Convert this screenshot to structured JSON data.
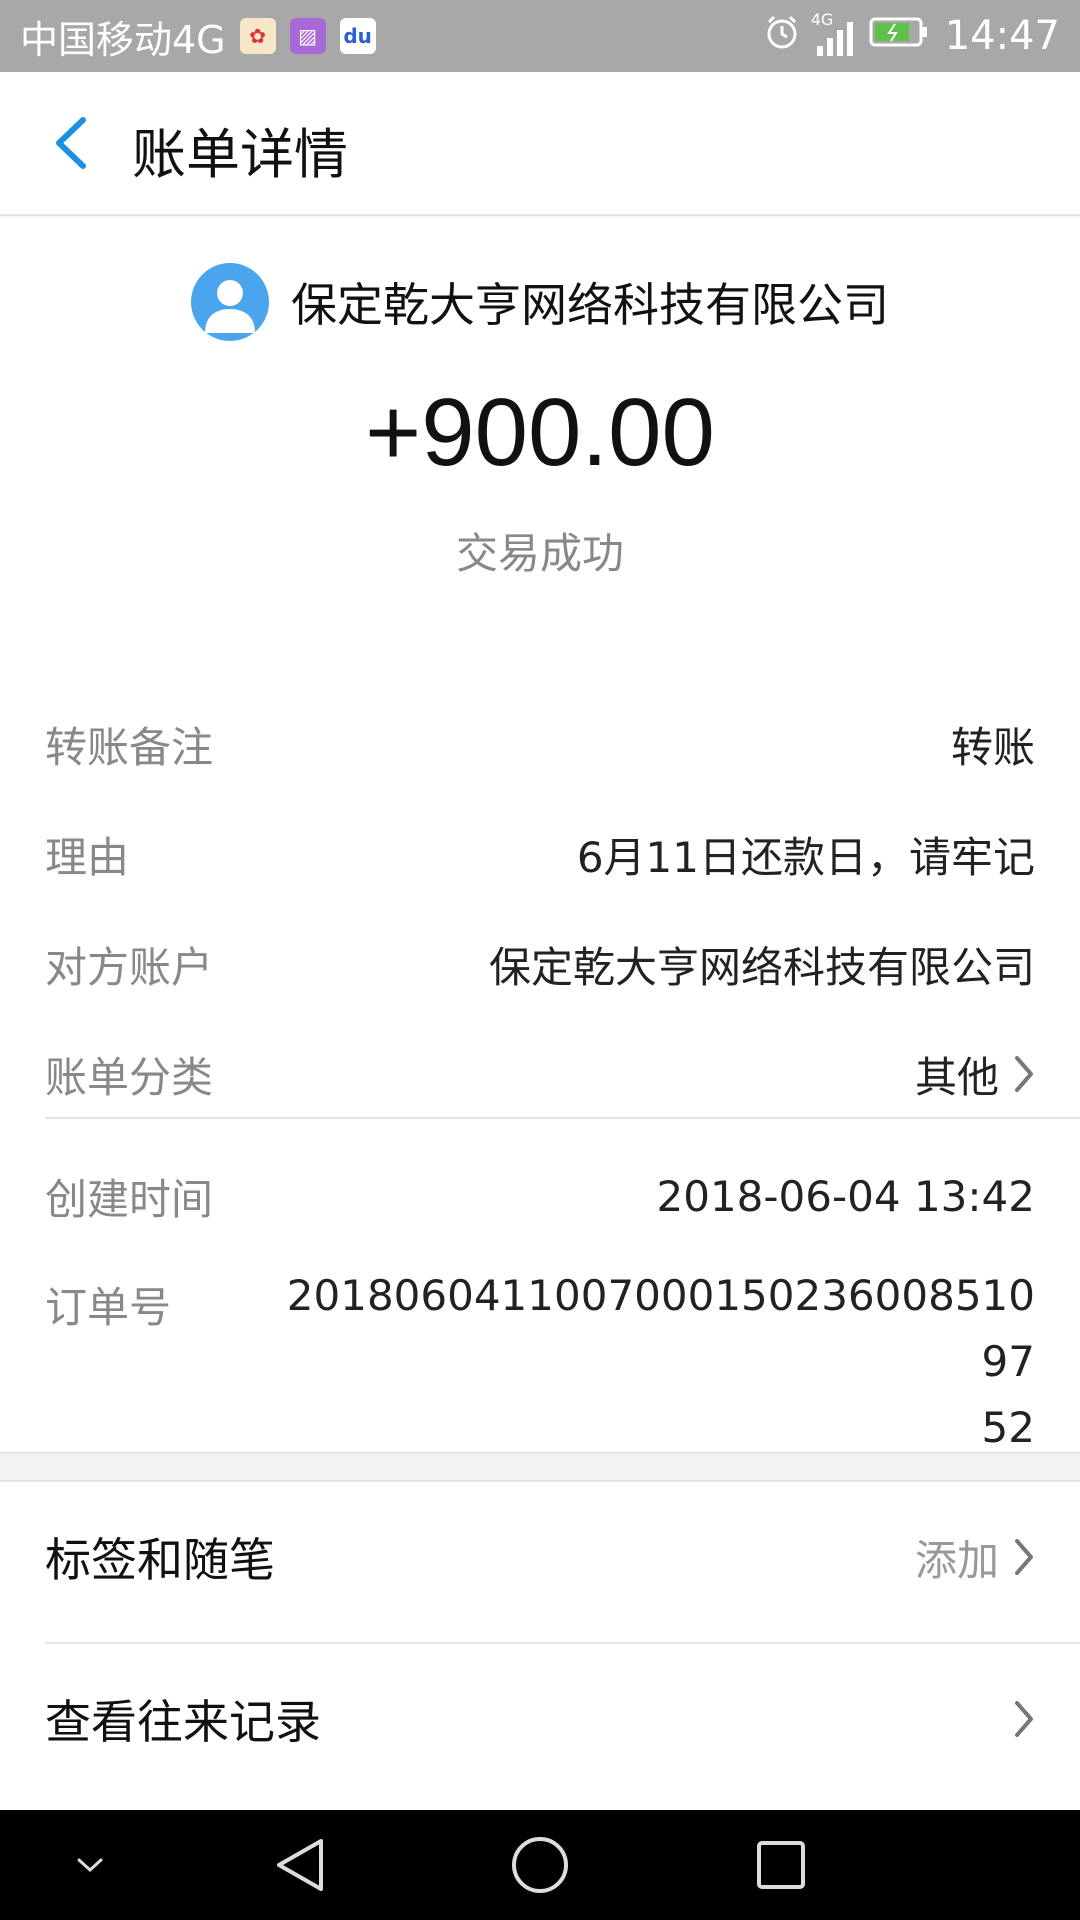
{
  "status_bar": {
    "carrier": "中国移动4G",
    "network": "4G",
    "time": "14:47"
  },
  "nav": {
    "title": "账单详情"
  },
  "transaction": {
    "payer_name": "保定乾大亨网络科技有限公司",
    "amount": "+900.00",
    "status": "交易成功"
  },
  "details": [
    {
      "label": "转账备注",
      "value": "转账"
    },
    {
      "label": "理由",
      "value": "6月11日还款日，请牢记"
    },
    {
      "label": "对方账户",
      "value": "保定乾大亨网络科技有限公司"
    },
    {
      "label": "账单分类",
      "value": "其他"
    }
  ],
  "meta": {
    "created_label": "创建时间",
    "created_value": "2018-06-04 13:42",
    "order_label": "订单号",
    "order_value": "2018060411007000150236008510975 2"
  },
  "list": {
    "tags_label": "标签和随笔",
    "tags_action": "添加",
    "history_label": "查看往来记录"
  },
  "colors": {
    "accent": "#1a8fe6",
    "avatar": "#4aa5ee"
  }
}
